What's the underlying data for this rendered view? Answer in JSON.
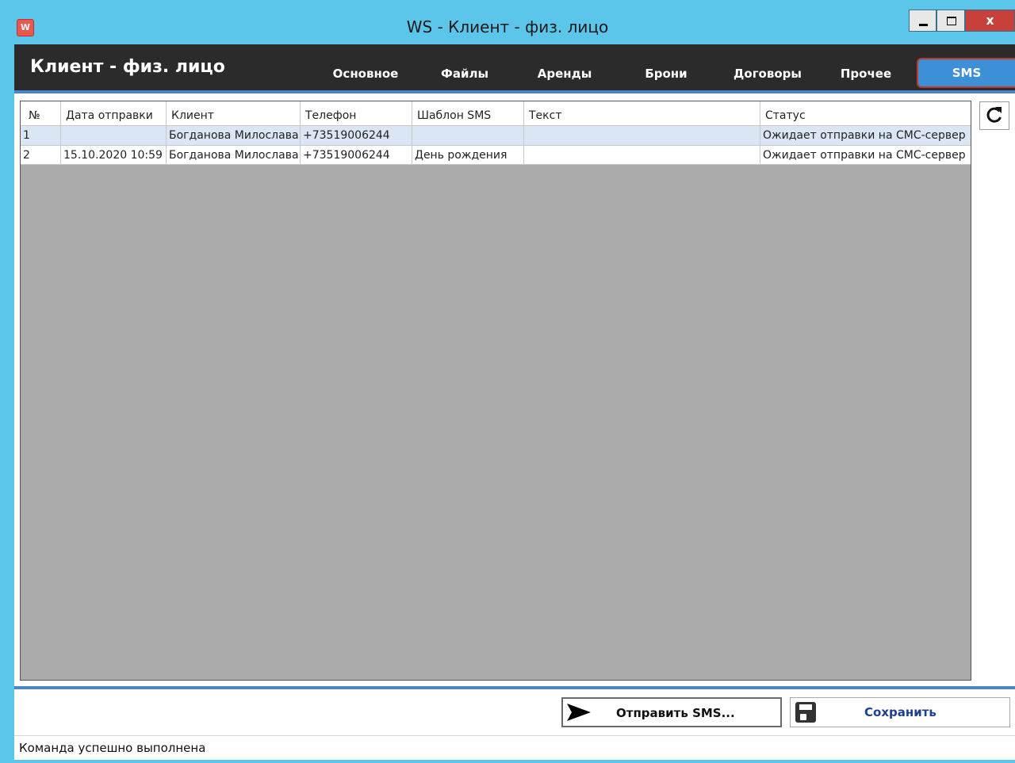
{
  "window": {
    "app_icon": "W",
    "title": "WS - Клиент - физ. лицо",
    "close_glyph": "x"
  },
  "header": {
    "title": "Клиент - физ. лицо",
    "tabs": [
      "Основное",
      "Файлы",
      "Аренды",
      "Брони",
      "Договоры",
      "Прочее",
      "SMS"
    ],
    "active_tab": "SMS"
  },
  "table": {
    "columns": [
      "№",
      "Дата отправки",
      "Клиент",
      "Телефон",
      "Шаблон SMS",
      "Текст",
      "Статус"
    ],
    "rows": [
      {
        "num": "1",
        "date": "",
        "client": "Богданова Милослава",
        "phone": "+73519006244",
        "template": "",
        "text": "",
        "status": "Ожидает отправки на СМС-сервер"
      },
      {
        "num": "2",
        "date": "15.10.2020 10:59",
        "client": "Богданова Милослава",
        "phone": "+73519006244",
        "template": "День рождения",
        "text": "",
        "status": "Ожидает отправки на СМС-сервер"
      }
    ]
  },
  "toolbar": {
    "refresh_icon": "refresh-icon",
    "send_label": "Отправить SMS...",
    "save_label": "Сохранить"
  },
  "status_bar": {
    "message": "Команда успешно выполнена"
  },
  "colors": {
    "window_frame": "#5cc5ea",
    "header_bg": "#2b2b2b",
    "active_tab": "#3d8fd6",
    "accent_line": "#4b85c8",
    "grid_bg": "#ababab",
    "selected_row": "#dbe6f4",
    "close_button": "#c7403a",
    "save_text": "#1c3f94"
  }
}
